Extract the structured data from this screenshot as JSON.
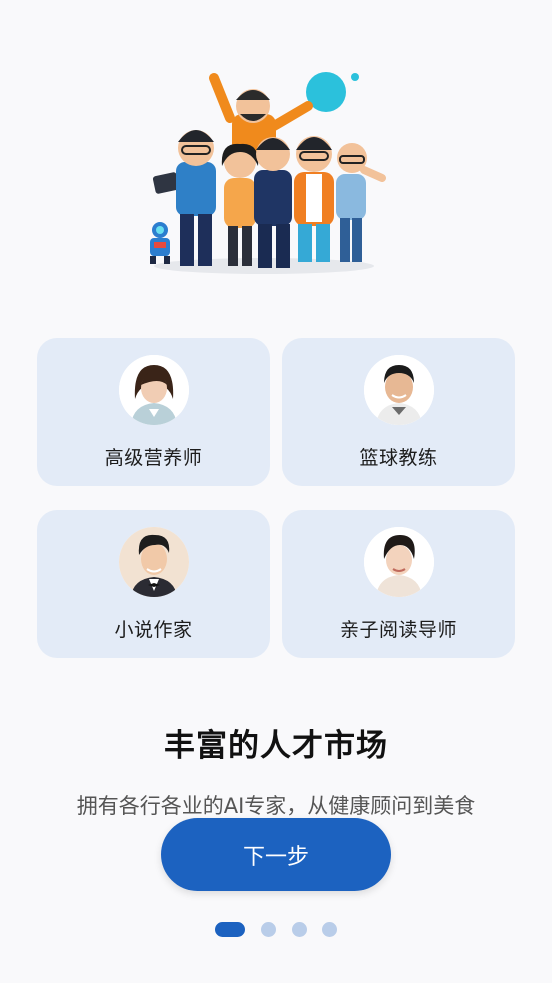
{
  "cards": [
    {
      "label": "高级营养师"
    },
    {
      "label": "篮球教练"
    },
    {
      "label": "小说作家"
    },
    {
      "label": "亲子阅读导师"
    }
  ],
  "title": "丰富的人才市场",
  "description": "拥有各行各业的AI专家，从健康顾问到美食",
  "next_button": "下一步",
  "pager": {
    "total": 4,
    "active_index": 0
  },
  "colors": {
    "accent": "#1c62c0",
    "card_bg": "#e3ebf7",
    "dot_inactive": "#b9cde9"
  }
}
